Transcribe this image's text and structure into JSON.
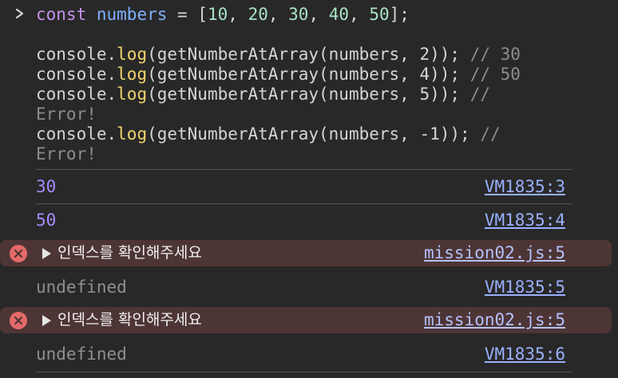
{
  "input": {
    "line1": {
      "kw": "const",
      "var": "numbers",
      "op": " = [",
      "n1": "10",
      "c1": ", ",
      "n2": "20",
      "c2": ", ",
      "n3": "30",
      "c3": ", ",
      "n4": "40",
      "c4": ", ",
      "n5": "50",
      "end": "];"
    },
    "calls": [
      {
        "pre": "console.",
        "fn": "log",
        "mid": "(getNumberAtArray(numbers, ",
        "arg": "2",
        "post": ")); ",
        "comment": "// 30"
      },
      {
        "pre": "console.",
        "fn": "log",
        "mid": "(getNumberAtArray(numbers, ",
        "arg": "4",
        "post": ")); ",
        "comment": "// 50"
      },
      {
        "pre": "console.",
        "fn": "log",
        "mid": "(getNumberAtArray(numbers, ",
        "arg": "5",
        "post": ")); ",
        "comment": "//",
        "comment_wrap": "Error!"
      },
      {
        "pre": "console.",
        "fn": "log",
        "mid": "(getNumberAtArray(numbers, ",
        "arg": "-1",
        "post": ")); ",
        "comment": "//",
        "comment_wrap": "Error!"
      }
    ]
  },
  "outputs": [
    {
      "type": "log",
      "value": "30",
      "source": "VM1835:3"
    },
    {
      "type": "log",
      "value": "50",
      "source": "VM1835:4"
    },
    {
      "type": "error",
      "value": "인덱스를 확인해주세요",
      "source": "mission02.js:5"
    },
    {
      "type": "undefined",
      "value": "undefined",
      "source": "VM1835:5"
    },
    {
      "type": "error",
      "value": "인덱스를 확인해주세요",
      "source": "mission02.js:5"
    },
    {
      "type": "undefined",
      "value": "undefined",
      "source": "VM1835:6"
    }
  ],
  "colors": {
    "background": "#282828",
    "error_background": "#4e3535",
    "error_icon": "#e46a6a",
    "link": "#9ab0ff",
    "number_output": "#a58bff"
  },
  "icons": {
    "prompt": "chevron-right-icon",
    "error": "error-circle-x-icon",
    "expand": "triangle-right-icon"
  }
}
